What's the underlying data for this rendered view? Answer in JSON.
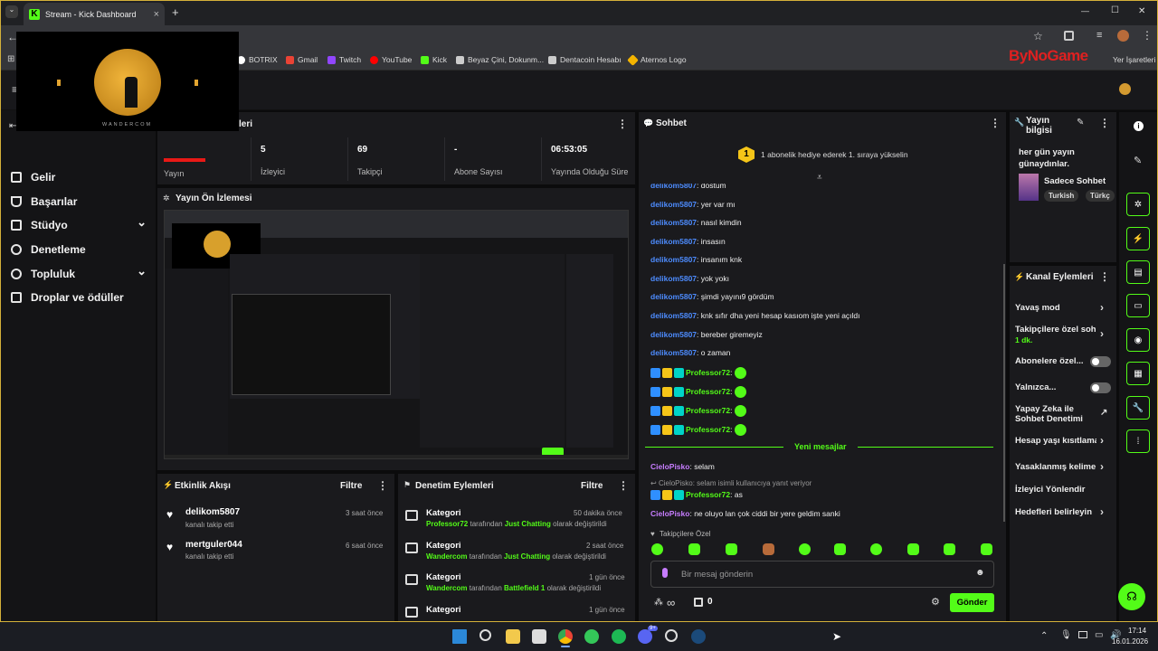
{
  "browser": {
    "tab_title": "Stream - Kick Dashboard",
    "tab_close": "×",
    "new_tab": "+",
    "win_min": "—",
    "win_max": "☐",
    "win_close": "✕"
  },
  "bookmarks": [
    "BOTRIX",
    "Gmail",
    "Twitch",
    "YouTube",
    "Kick",
    "Beyaz Çini, Dokunm...",
    "Dentacoin Hesabı",
    "Aternos Logo",
    "Yer İşaretleri"
  ],
  "bookmark_colors": [
    "#ffffff",
    "#ea4335",
    "#9146ff",
    "#ff0000",
    "#53fc18",
    "#cccccc",
    "#cccccc",
    "#f4b400",
    "#cccccc"
  ],
  "watermark": "ByNoGame",
  "overlay": {
    "caption": "WANDERCOM"
  },
  "sidebar": {
    "items": [
      {
        "label": "Gelir",
        "icon": "revenue-icon",
        "arrow": ""
      },
      {
        "label": "Başarılar",
        "icon": "trophy-icon",
        "arrow": ""
      },
      {
        "label": "Stüdyo",
        "icon": "studio-icon",
        "arrow": "⌄"
      },
      {
        "label": "Denetleme",
        "icon": "wrench-icon",
        "arrow": ""
      },
      {
        "label": "Topluluk",
        "icon": "community-icon",
        "arrow": "⌄"
      },
      {
        "label": "Droplar ve ödüller",
        "icon": "drops-icon",
        "arrow": ""
      }
    ]
  },
  "stats": {
    "title_suffix": "leri",
    "items": [
      {
        "value": "",
        "label": "Yayın"
      },
      {
        "value": "5",
        "label": "İzleyici"
      },
      {
        "value": "69",
        "label": "Takipçi"
      },
      {
        "value": "-",
        "label": "Abone Sayısı"
      },
      {
        "value": "06:53:05",
        "label": "Yayında Olduğu Süre"
      }
    ]
  },
  "preview": {
    "title": "Yayın Ön İzlemesi"
  },
  "activity": {
    "title": "Etkinlik Akışı",
    "filter": "Filtre",
    "items": [
      {
        "user": "delikom5807",
        "text": "kanalı takip etti",
        "time": "3 saat önce"
      },
      {
        "user": "mertguler044",
        "text": "kanalı takip etti",
        "time": "6 saat önce"
      }
    ]
  },
  "moderation": {
    "title": "Denetim Eylemleri",
    "filter": "Filtre",
    "items": [
      {
        "head": "Kategori",
        "time": "50 dakika önce",
        "actor": "Professor72",
        "mid": "tarafından",
        "target": "Just Chatting",
        "tail": "olarak değiştirildi"
      },
      {
        "head": "Kategori",
        "time": "2 saat önce",
        "actor": "Wandercom",
        "mid": "tarafından",
        "target": "Just Chatting",
        "tail": "olarak değiştirildi"
      },
      {
        "head": "Kategori",
        "time": "1 gün önce",
        "actor": "Wandercom",
        "mid": "tarafından",
        "target": "Battlefield 1",
        "tail": "olarak değiştirildi"
      },
      {
        "head": "Kategori",
        "time": "1 gün önce",
        "actor": "",
        "mid": "",
        "target": "",
        "tail": ""
      }
    ]
  },
  "chat": {
    "title": "Sohbet",
    "pinned_num": "1",
    "pinned": "1 abonelik hediye ederek 1. sıraya yükselin",
    "messages": [
      {
        "user": "delikom5807",
        "text": ": dostum"
      },
      {
        "user": "delikom5807",
        "text": ": yer var mı"
      },
      {
        "user": "delikom5807",
        "text": ": nasıl kimdin"
      },
      {
        "user": "delikom5807",
        "text": ": insasın"
      },
      {
        "user": "delikom5807",
        "text": ": insanım knk"
      },
      {
        "user": "delikom5807",
        "text": ": yok yokı"
      },
      {
        "user": "delikom5807",
        "text": ": şimdi yayını9 gördüm"
      },
      {
        "user": "delikom5807",
        "text": ": knk sıfır dha yeni hesap kasıom işte yeni açıldı"
      },
      {
        "user": "delikom5807",
        "text": ": bereber giremeyiz"
      },
      {
        "user": "delikom5807",
        "text": ": o zaman"
      }
    ],
    "prof_user": "Professor72",
    "prof_sep": ":",
    "new_label": "Yeni mesajlar",
    "m1_user": "CieloPisko",
    "m1_text": ": selam",
    "reply_hint": "CieloPisko: selam isimli kullanıcıya yanıt veriyor",
    "m2_text": ": as",
    "m3_text": ": ne oluyo lan çok ciddi bir yere geldim sanki",
    "followers_label": "Takipçilere Özel",
    "input_placeholder": "Bir mesaj gönderin",
    "infinity": "∞",
    "gift_count": "0",
    "send": "Gönder"
  },
  "info": {
    "title": "Yayın bilgisi",
    "stream_title": "her gün yayın günaydınlar.",
    "category": "Sadece Sohbet",
    "tags": [
      "Turkish",
      "Türkç"
    ]
  },
  "actions": {
    "title": "Kanal Eylemleri",
    "items": [
      {
        "label": "Yavaş mod",
        "kind": "chev",
        "sub": ""
      },
      {
        "label": "Takipçilere özel sohl",
        "kind": "chev",
        "sub": "1 dk."
      },
      {
        "label": "Abonelere özel...",
        "kind": "toggle",
        "sub": ""
      },
      {
        "label": "Yalnızca...",
        "kind": "toggle",
        "sub": ""
      },
      {
        "label": "Yapay Zeka ile Sohbet Denetimi",
        "kind": "ext",
        "sub": ""
      },
      {
        "label": "Hesap yaşı kısıtlama",
        "kind": "chev",
        "sub": ""
      },
      {
        "label": "Yasaklanmış kelime",
        "kind": "chev",
        "sub": ""
      },
      {
        "label": "İzleyici Yönlendir",
        "kind": "none",
        "sub": ""
      },
      {
        "label": "Hedefleri belirleyin",
        "kind": "chev",
        "sub": ""
      }
    ]
  },
  "taskbar": {
    "time": "17:14",
    "date": "16.01.2026",
    "badge": "9+"
  }
}
